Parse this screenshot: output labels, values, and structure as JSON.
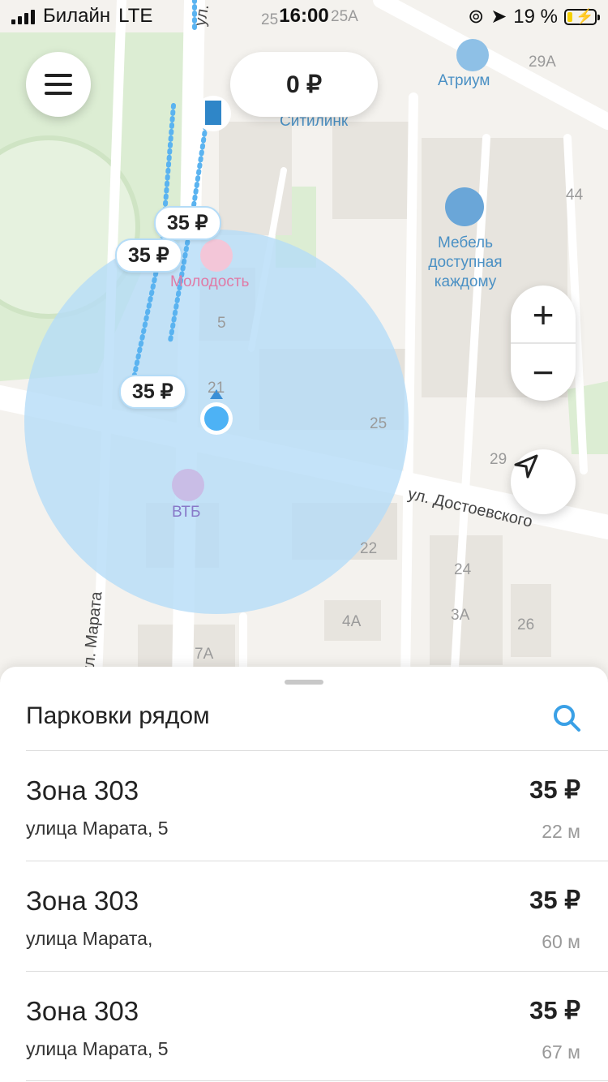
{
  "status_bar": {
    "carrier": "Билайн",
    "network": "LTE",
    "time": "16:00",
    "battery_percent": "19 %"
  },
  "header": {
    "balance": "0 ₽"
  },
  "map": {
    "price_pins": [
      "35 ₽",
      "35 ₽",
      "35 ₽"
    ],
    "pois": {
      "atrium": "Атриум",
      "citilink": "Ситилинк",
      "furniture": "Мебель\nдоступная\nкаждому",
      "molodost": "Молодость",
      "vtb": "ВТБ"
    },
    "building_numbers": [
      "25",
      "25А",
      "29А",
      "44",
      "5",
      "21",
      "25",
      "29",
      "22",
      "24",
      "3А",
      "26",
      "4А",
      "7А"
    ],
    "streets": {
      "marata_top": "ул. Марата",
      "marata_bottom": "ул. Марата",
      "dostoevskogo": "ул. Достоевского"
    },
    "controls": {
      "zoom_in": "+",
      "zoom_out": "−"
    }
  },
  "sheet": {
    "title": "Парковки рядом",
    "items": [
      {
        "zone": "Зона 303",
        "address": "улица Марата, 5",
        "price": "35 ₽",
        "distance": "22 м"
      },
      {
        "zone": "Зона 303",
        "address": "улица Марата,",
        "price": "35 ₽",
        "distance": "60 м"
      },
      {
        "zone": "Зона 303",
        "address": "улица Марата, 5",
        "price": "35 ₽",
        "distance": "67 м"
      }
    ]
  },
  "colors": {
    "accent": "#3aa0e6",
    "accuracy_circle": "#b5dcf7",
    "park": "#d9ecd0"
  }
}
